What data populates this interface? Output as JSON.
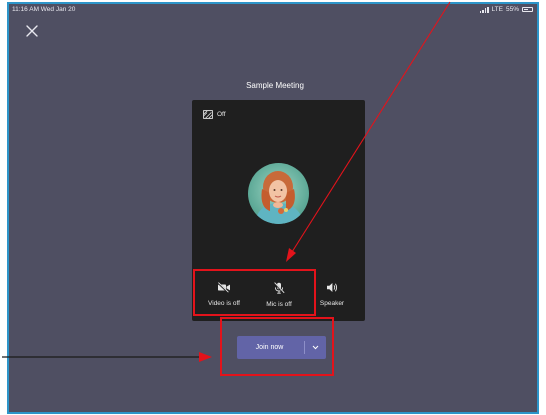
{
  "status_bar": {
    "time": "11:16 AM  Wed Jan 20",
    "network": "LTE",
    "battery": "55%"
  },
  "meeting": {
    "title": "Sample Meeting"
  },
  "background_toggle": {
    "label": "Off"
  },
  "controls": {
    "video_label": "Video is off",
    "mic_label": "Mic is off",
    "speaker_label": "Speaker"
  },
  "join": {
    "label": "Join now"
  },
  "colors": {
    "background": "#4f4f62",
    "card": "#1f1f1f",
    "accent": "#6264a7",
    "highlight": "#e3131b",
    "frame": "#2d95c9"
  },
  "icons": [
    "close-icon",
    "background-effects-icon",
    "video-off-icon",
    "mic-off-icon",
    "speaker-icon",
    "chevron-down-icon",
    "signal-icon",
    "battery-icon"
  ]
}
